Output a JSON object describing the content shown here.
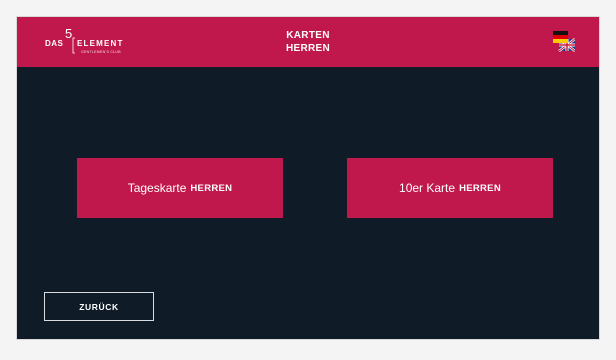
{
  "header": {
    "logo": {
      "das": "DAS",
      "five": "5",
      "element": "ELEMENT",
      "subtitle": "GENTLEMEN'S CLUB"
    },
    "title_line1": "KARTEN",
    "title_line2": "HERREN",
    "language_flag_icon": "germany-uk-flag-icon"
  },
  "main": {
    "buttons": [
      {
        "label": "Tageskarte",
        "suffix": "HERREN"
      },
      {
        "label": "10er Karte",
        "suffix": "HERREN"
      }
    ],
    "back_label": "ZURÜCK"
  },
  "colors": {
    "brand": "#c0184c",
    "background": "#0f1c28",
    "page": "#f4f4f4"
  }
}
